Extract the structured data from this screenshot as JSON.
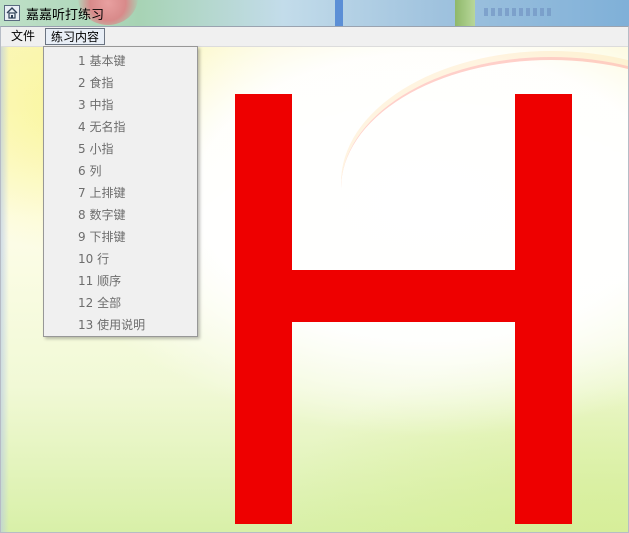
{
  "window": {
    "title": "嘉嘉听打练习",
    "icon": "app-house-icon"
  },
  "menubar": {
    "file_label": "文件",
    "practice_label": "练习内容"
  },
  "practice_menu": {
    "items": [
      "1  基本键",
      "2  食指",
      "3  中指",
      "4  无名指",
      "5  小指",
      "6  列",
      "7  上排键",
      "8  数字键",
      "9  下排键",
      "10 行",
      "11 顺序",
      "12 全部",
      "13 使用说明"
    ]
  },
  "display": {
    "letter": "H",
    "letter_color": "#ee0000"
  }
}
